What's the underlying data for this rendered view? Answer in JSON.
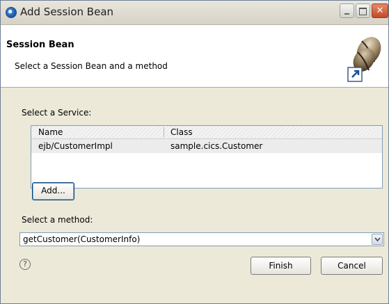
{
  "window": {
    "title": "Add Session Bean"
  },
  "banner": {
    "title": "Session Bean",
    "description": "Select a Session Bean and a method",
    "icon": "session-bean-icon"
  },
  "service": {
    "label": "Select a Service:",
    "columns": [
      "Name",
      "Class"
    ],
    "rows": [
      {
        "name": "ejb/CustomerImpl",
        "class": "sample.cics.Customer"
      }
    ],
    "add_label": "Add..."
  },
  "method": {
    "label": "Select a method:",
    "value": "getCustomer(CustomerInfo)"
  },
  "footer": {
    "help_icon": "help-icon",
    "finish_label": "Finish",
    "cancel_label": "Cancel"
  }
}
